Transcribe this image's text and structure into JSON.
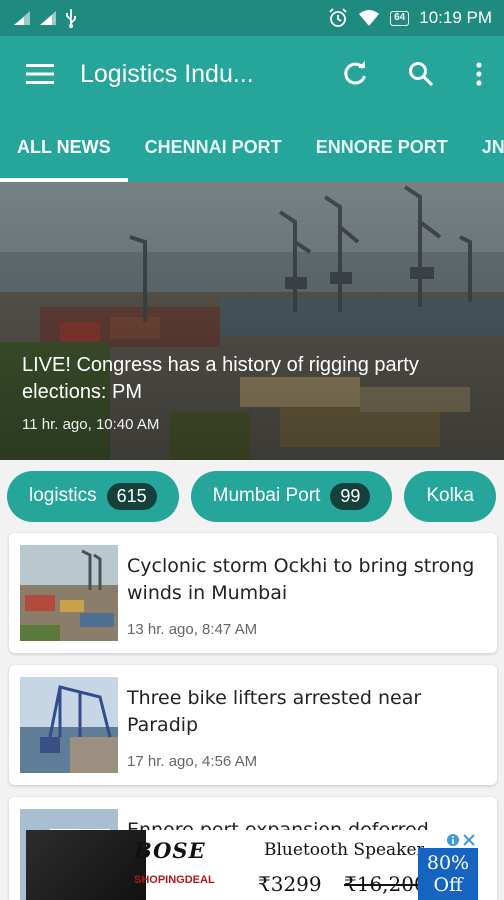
{
  "status_bar": {
    "battery": "64",
    "time": "10:19 PM"
  },
  "app_bar": {
    "title": "Logistics Indu...",
    "icons": [
      "menu-icon",
      "refresh-icon",
      "search-icon",
      "more-vert-icon"
    ]
  },
  "tabs": [
    {
      "label": "ALL NEWS",
      "active": true
    },
    {
      "label": "CHENNAI PORT",
      "active": false
    },
    {
      "label": "ENNORE PORT",
      "active": false
    },
    {
      "label": "JN",
      "active": false
    }
  ],
  "hero": {
    "headline": "LIVE! Congress has a history of rigging party elections: PM",
    "time": "11 hr. ago, 10:40 AM"
  },
  "chips": [
    {
      "label": "logistics",
      "count": "615"
    },
    {
      "label": "Mumbai Port",
      "count": "99"
    },
    {
      "label": "Kolka",
      "count": ""
    }
  ],
  "articles": [
    {
      "title": "Cyclonic storm Ockhi to bring strong winds in Mumbai",
      "time": "13 hr. ago, 8:47 AM"
    },
    {
      "title": "Three bike lifters arrested near Paradip",
      "time": "17 hr. ago, 4:56 AM"
    },
    {
      "title": "Ennore port expansion deferred",
      "time": ""
    }
  ],
  "ad": {
    "brand": "BOSE",
    "product": "Bluetooth Speaker",
    "shop": "SHOPINGDEAL",
    "price": "₹3299",
    "old_price": "₹16,200",
    "discount_value": "80%",
    "discount_word": "Off"
  },
  "colors": {
    "status_bar": "#1f8a80",
    "primary": "#26a69a",
    "chip_count_bg": "#15403c",
    "background": "#f2f2f2"
  }
}
